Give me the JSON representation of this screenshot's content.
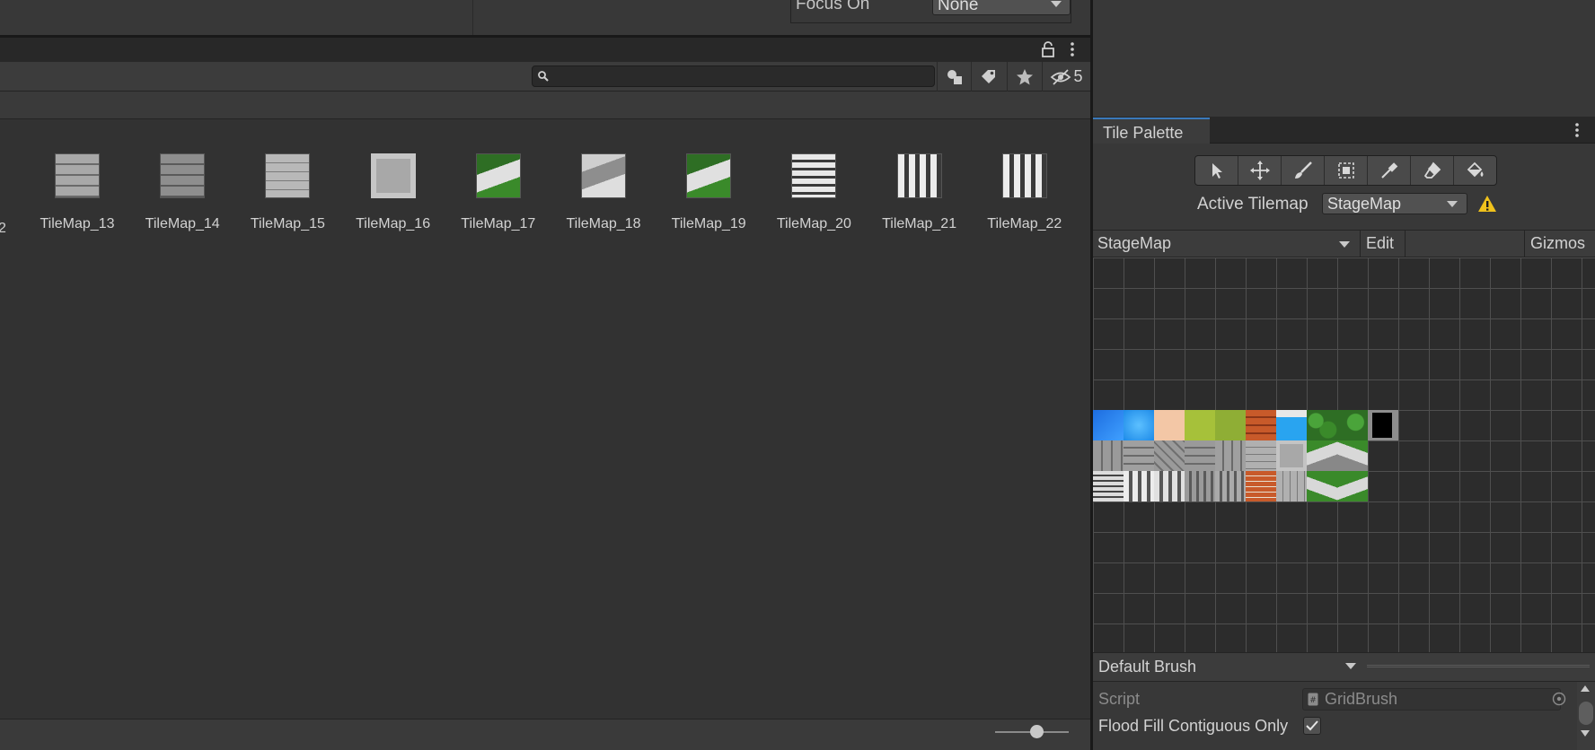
{
  "top": {
    "focus_on_label": "Focus On",
    "focus_on_value": "None"
  },
  "project": {
    "hidden_count": "5",
    "partial_asset_label": "2",
    "assets": [
      {
        "name": "TileMap_13",
        "icon": "stone-block-tile"
      },
      {
        "name": "TileMap_14",
        "icon": "stone-block-dark-tile"
      },
      {
        "name": "TileMap_15",
        "icon": "stone-brick-wall-tile"
      },
      {
        "name": "TileMap_16",
        "icon": "stone-frame-tile"
      },
      {
        "name": "TileMap_17",
        "icon": "forest-mountain-tile"
      },
      {
        "name": "TileMap_18",
        "icon": "rock-mountain-tile"
      },
      {
        "name": "TileMap_19",
        "icon": "forest-mountain-tile"
      },
      {
        "name": "TileMap_20",
        "icon": "stairs-tile"
      },
      {
        "name": "TileMap_21",
        "icon": "pillar-tile"
      },
      {
        "name": "TileMap_22",
        "icon": "pillar-tile"
      }
    ]
  },
  "palette": {
    "tab_label": "Tile Palette",
    "tools": [
      "select-tool",
      "move-tool",
      "brush-tool",
      "box-fill-tool",
      "picker-tool",
      "eraser-tool",
      "fill-tool"
    ],
    "active_tilemap_label": "Active Tilemap",
    "active_tilemap_value": "StageMap",
    "palette_name": "StageMap",
    "edit_label": "Edit",
    "gizmos_label": "Gizmos",
    "brush_name": "Default Brush",
    "script_label": "Script",
    "script_value": "GridBrush",
    "flood_fill_label": "Flood Fill Contiguous Only",
    "flood_fill_checked": true
  },
  "colors": {
    "accent": "#3a79bb",
    "warning": "#f0c21c"
  }
}
